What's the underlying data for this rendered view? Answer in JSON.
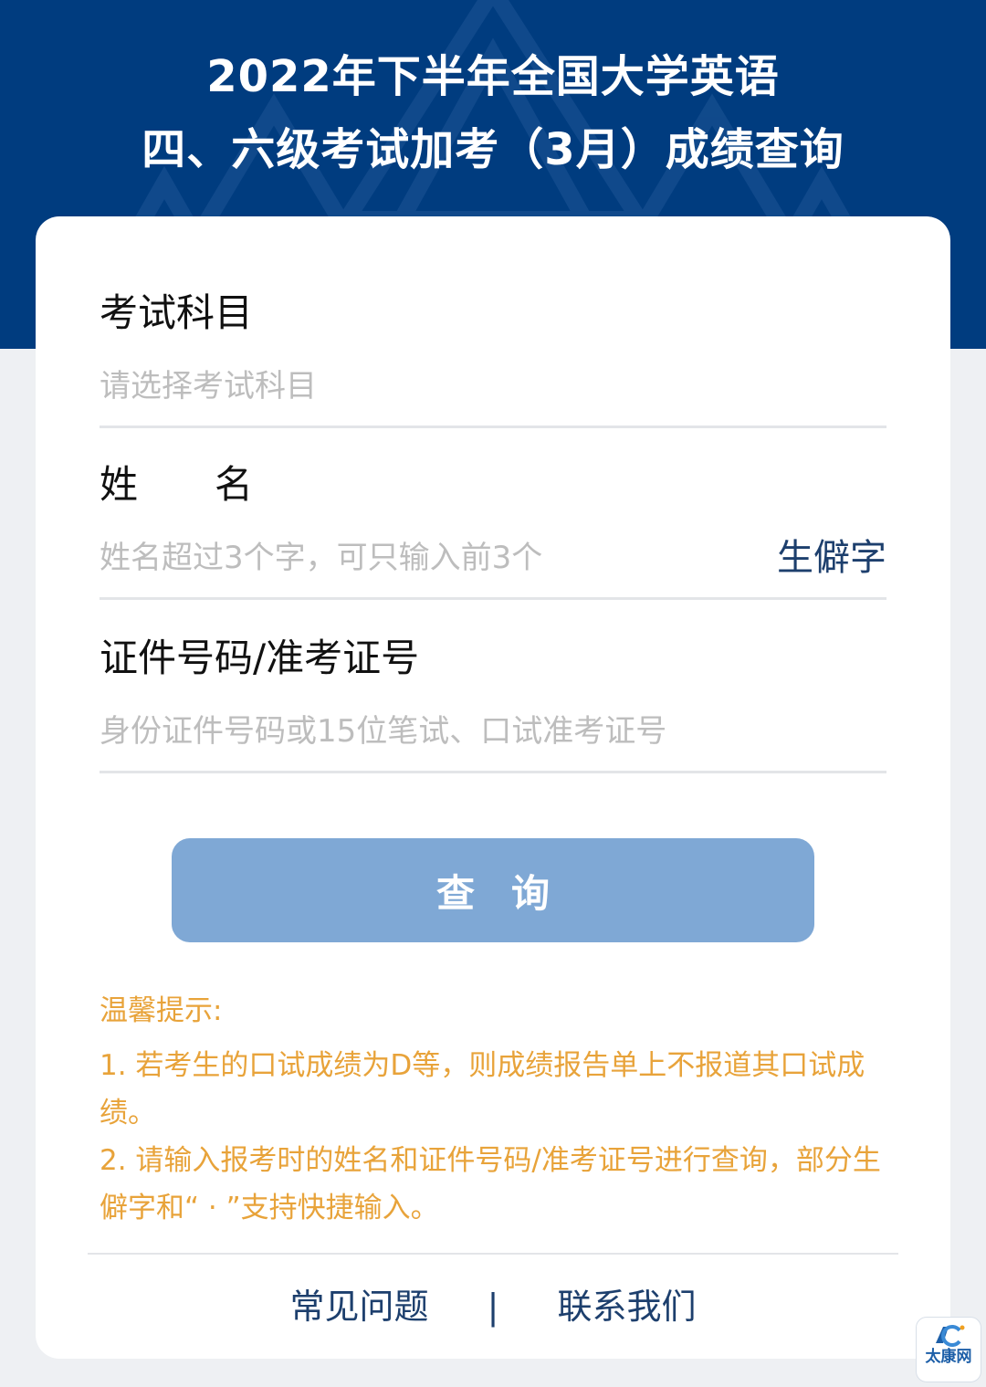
{
  "header": {
    "title_line1": "2022年下半年全国大学英语",
    "title_line2": "四、六级考试加考（3月）成绩查询"
  },
  "form": {
    "subject": {
      "label": "考试科目",
      "placeholder": "请选择考试科目"
    },
    "name": {
      "label": "姓　　名",
      "placeholder": "姓名超过3个字，可只输入前3个",
      "rare_char_label": "生僻字"
    },
    "id": {
      "label": "证件号码/准考证号",
      "placeholder": "身份证件号码或15位笔试、口试准考证号"
    },
    "query_button": "查询"
  },
  "tips": {
    "title": "温馨提示:",
    "items": [
      "1. 若考生的口试成绩为D等，则成绩报告单上不报道其口试成绩。",
      "2. 请输入报考时的姓名和证件号码/准考证号进行查询，部分生僻字和“ · ”支持快捷输入。"
    ]
  },
  "footer": {
    "faq": "常见问题",
    "separator": "|",
    "contact": "联系我们"
  },
  "watermark": {
    "text": "太康网"
  },
  "colors": {
    "header_bg": "#003c7f",
    "button_bg": "#7fa8d5",
    "tip_text": "#e8a33a",
    "link_text": "#1d3f6d"
  }
}
